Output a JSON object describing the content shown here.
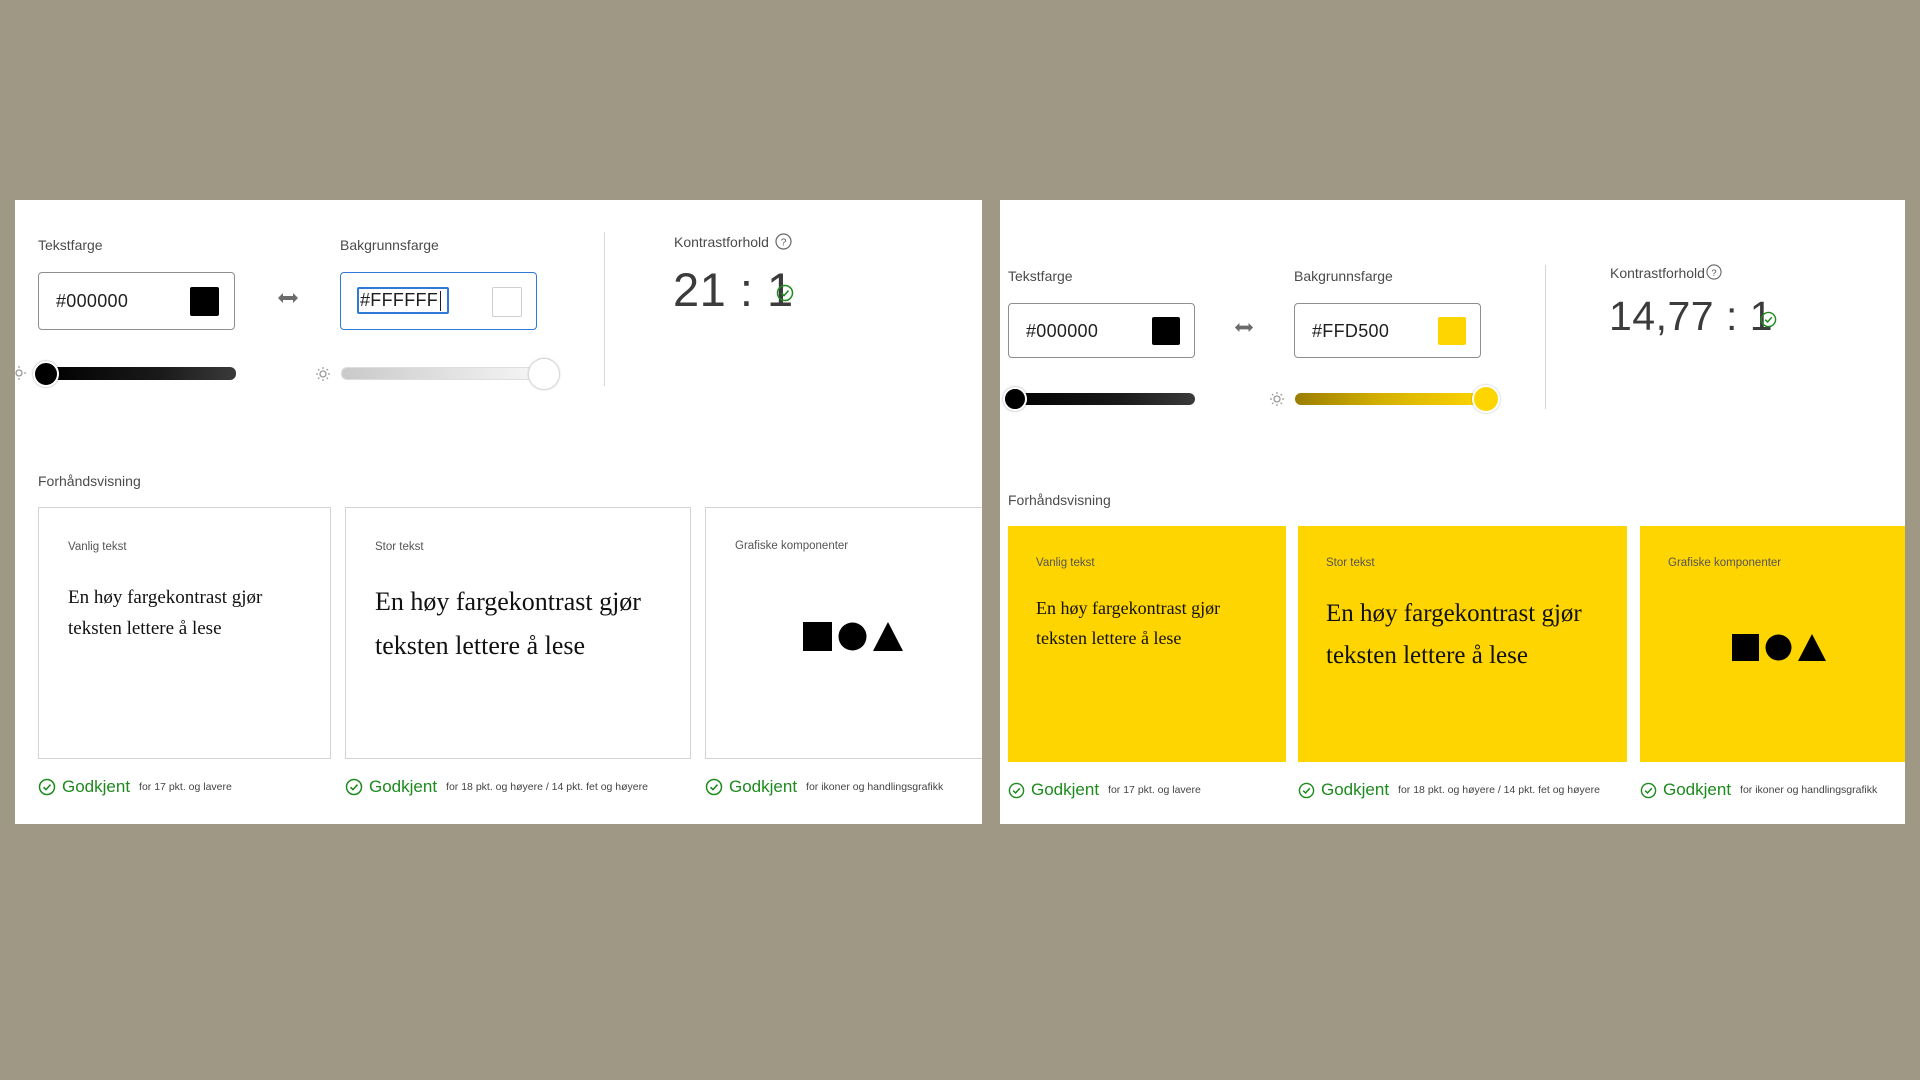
{
  "left": {
    "text_color": {
      "label": "Tekstfarge",
      "value": "#000000",
      "swatch": "#000000"
    },
    "background_color": {
      "label": "Bakgrunnsfarge",
      "value": "#FFFFFF",
      "swatch": "#FFFFFF"
    },
    "text_slider_level": 0.0,
    "background_slider_level": 1.0,
    "contrast": {
      "label": "Kontrastforhold",
      "ratio": "21 : 1"
    },
    "preview": {
      "label": "Forhåndsvisning",
      "cards": [
        {
          "title": "Vanlig tekst",
          "text": "En høy fargekontrast gjør teksten lettere å lese"
        },
        {
          "title": "Stor tekst",
          "text": "En høy fargekontrast gjør teksten lettere å lese"
        },
        {
          "title": "Grafiske komponenter",
          "text": ""
        }
      ],
      "statuses": [
        {
          "word": "Godkjent",
          "note": "for 17 pkt. og lavere"
        },
        {
          "word": "Godkjent",
          "note": "for 18 pkt. og høyere / 14 pkt. fet og høyere"
        },
        {
          "word": "Godkjent",
          "note": "for ikoner og handlingsgrafikk"
        }
      ]
    }
  },
  "right": {
    "text_color": {
      "label": "Tekstfarge",
      "value": "#000000",
      "swatch": "#000000"
    },
    "background_color": {
      "label": "Bakgrunnsfarge",
      "value": "#FFD500",
      "swatch": "#FFD500"
    },
    "text_slider_level": 0.0,
    "background_slider_level": 1.0,
    "contrast": {
      "label": "Kontrastforhold",
      "ratio": "14,77 : 1"
    },
    "preview": {
      "label": "Forhåndsvisning",
      "cards": [
        {
          "title": "Vanlig tekst",
          "text": "En høy fargekontrast gjør teksten lettere å lese"
        },
        {
          "title": "Stor tekst",
          "text": "En høy fargekontrast gjør teksten lettere å lese"
        },
        {
          "title": "Grafiske komponenter",
          "text": ""
        }
      ],
      "statuses": [
        {
          "word": "Godkjent",
          "note": "for 17 pkt. og lavere"
        },
        {
          "word": "Godkjent",
          "note": "for 18 pkt. og høyere / 14 pkt. fet og høyere"
        },
        {
          "word": "Godkjent",
          "note": "for ikoner og handlingsgrafikk"
        }
      ]
    }
  },
  "colors": {
    "page_background": "#9f9884",
    "approved_green": "#1d8a1d",
    "focus_blue": "#2f7ad6",
    "yellow": "#FFD500"
  },
  "icons": [
    "swap-arrows-icon",
    "brightness-icon",
    "help-circle-icon",
    "check-circle-icon",
    "square-shape-icon",
    "circle-shape-icon",
    "triangle-shape-icon"
  ]
}
